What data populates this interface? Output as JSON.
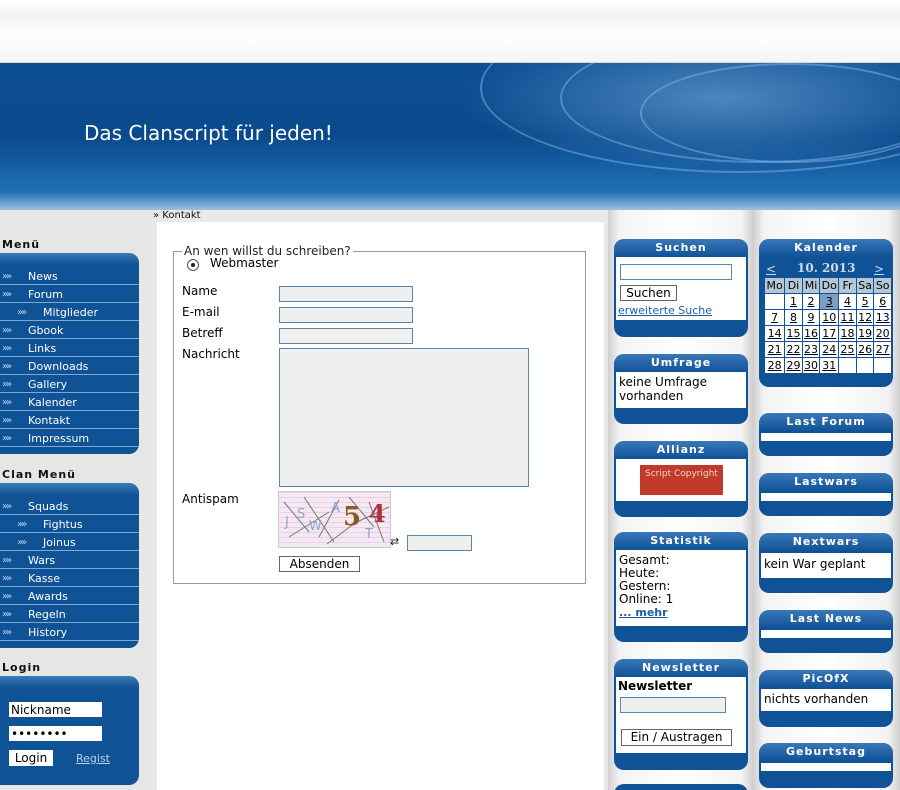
{
  "banner": {
    "title": "Das Clanscript für jeden!"
  },
  "breadcrumb": "» Kontakt",
  "left": {
    "menu_title": "Menü",
    "menu_items": [
      {
        "label": "News",
        "sub": false
      },
      {
        "label": "Forum",
        "sub": false
      },
      {
        "label": "Mitglieder",
        "sub": true
      },
      {
        "label": "Gbook",
        "sub": false
      },
      {
        "label": "Links",
        "sub": false
      },
      {
        "label": "Downloads",
        "sub": false
      },
      {
        "label": "Gallery",
        "sub": false
      },
      {
        "label": "Kalender",
        "sub": false
      },
      {
        "label": "Kontakt",
        "sub": false
      },
      {
        "label": "Impressum",
        "sub": false
      }
    ],
    "clan_title": "Clan Menü",
    "clan_items": [
      {
        "label": "Squads",
        "sub": false
      },
      {
        "label": "Fightus",
        "sub": true
      },
      {
        "label": "Joinus",
        "sub": true
      },
      {
        "label": "Wars",
        "sub": false
      },
      {
        "label": "Kasse",
        "sub": false
      },
      {
        "label": "Awards",
        "sub": false
      },
      {
        "label": "Regeln",
        "sub": false
      },
      {
        "label": "History",
        "sub": false
      }
    ],
    "login_title": "Login",
    "nickname_value": "Nickname",
    "password_value": "••••••••",
    "login_button": "Login",
    "regist_link": "Regist"
  },
  "contact": {
    "legend": "An wen willst du schreiben?",
    "recipient": "Webmaster",
    "name_label": "Name",
    "email_label": "E-mail",
    "subject_label": "Betreff",
    "message_label": "Nachricht",
    "antispam_label": "Antispam",
    "captcha_text": "5 4",
    "refresh_icon": "refresh-icon",
    "submit": "Absenden"
  },
  "mid": {
    "search_title": "Suchen",
    "search_button": "Suchen",
    "advanced_search": "erweiterte Suche",
    "poll_title": "Umfrage",
    "poll_text": "keine Umfrage vorhanden",
    "alliance_title": "Allianz",
    "alliance_banner": "Script Copyright",
    "stats_title": "Statistik",
    "stats": {
      "total": "Gesamt:",
      "today": "Heute:",
      "yesterday": "Gestern:",
      "online": "Online: 1",
      "more": "... mehr"
    },
    "newsletter_title": "Newsletter",
    "newsletter_label": "Newsletter",
    "newsletter_button": "Ein / Austragen"
  },
  "right": {
    "calendar_title": "Kalender",
    "calendar_prev": "<",
    "calendar_month": "10. 2013",
    "calendar_next": ">",
    "calendar_days": [
      "Mo",
      "Di",
      "Mi",
      "Do",
      "Fr",
      "Sa",
      "So"
    ],
    "calendar_rows": [
      [
        "",
        "1",
        "2",
        "3",
        "4",
        "5",
        "6"
      ],
      [
        "7",
        "8",
        "9",
        "10",
        "11",
        "12",
        "13"
      ],
      [
        "14",
        "15",
        "16",
        "17",
        "18",
        "19",
        "20"
      ],
      [
        "21",
        "22",
        "23",
        "24",
        "25",
        "26",
        "27"
      ],
      [
        "28",
        "29",
        "30",
        "31",
        "",
        "",
        ""
      ]
    ],
    "calendar_today": "3",
    "lastforum_title": "Last Forum",
    "lastwars_title": "Lastwars",
    "nextwars_title": "Nextwars",
    "nextwars_text": "kein War geplant",
    "lastnews_title": "Last News",
    "picofx_title": "PicOfX",
    "picofx_text": "nichts vorhanden",
    "birthday_title": "Geburtstag"
  }
}
